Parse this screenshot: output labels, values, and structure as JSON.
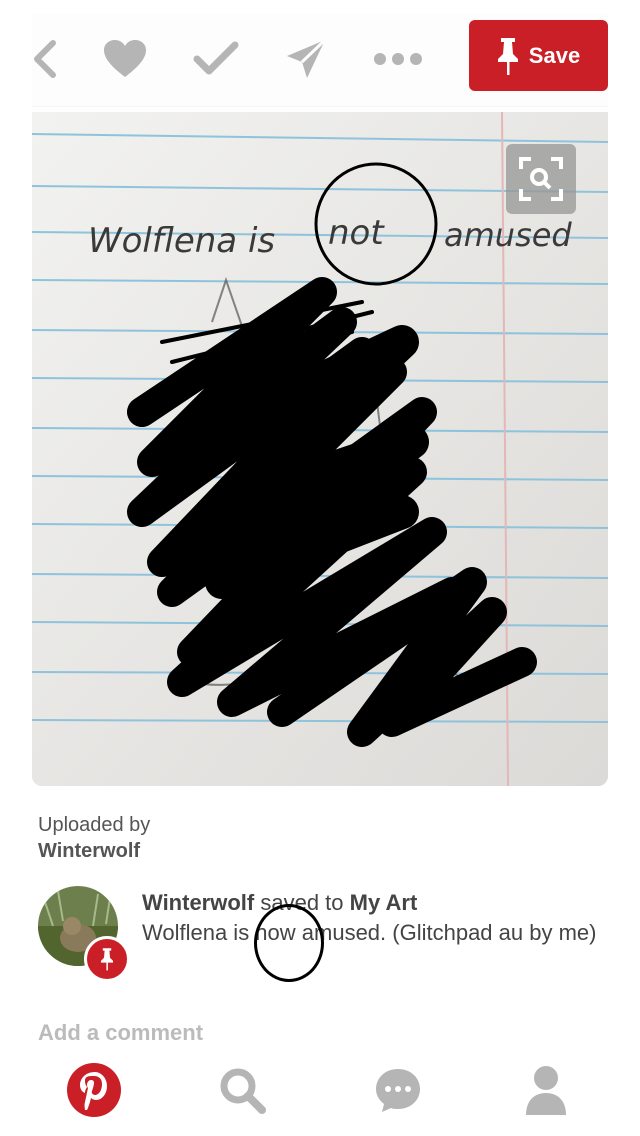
{
  "toolbar": {
    "save_label": "Save",
    "icons": [
      "back-icon",
      "heart-icon",
      "check-icon",
      "send-icon",
      "more-icon"
    ]
  },
  "photo": {
    "handwriting_1": "Wolflena is",
    "handwriting_2": "not",
    "handwriting_3": "amused"
  },
  "uploaded": {
    "prefix": "Uploaded by",
    "user": "Winterwolf"
  },
  "pin": {
    "user": "Winterwolf",
    "saved_to": "saved to",
    "board": "My Art",
    "description": "Wolflena is now amused. (Glitchpad au by me)"
  },
  "comment": {
    "placeholder": "Add a comment"
  },
  "colors": {
    "brand": "#cb1f27",
    "icon_gray": "#b5b5b5"
  },
  "tabs": [
    "home-icon",
    "search-icon",
    "messages-icon",
    "profile-icon"
  ]
}
